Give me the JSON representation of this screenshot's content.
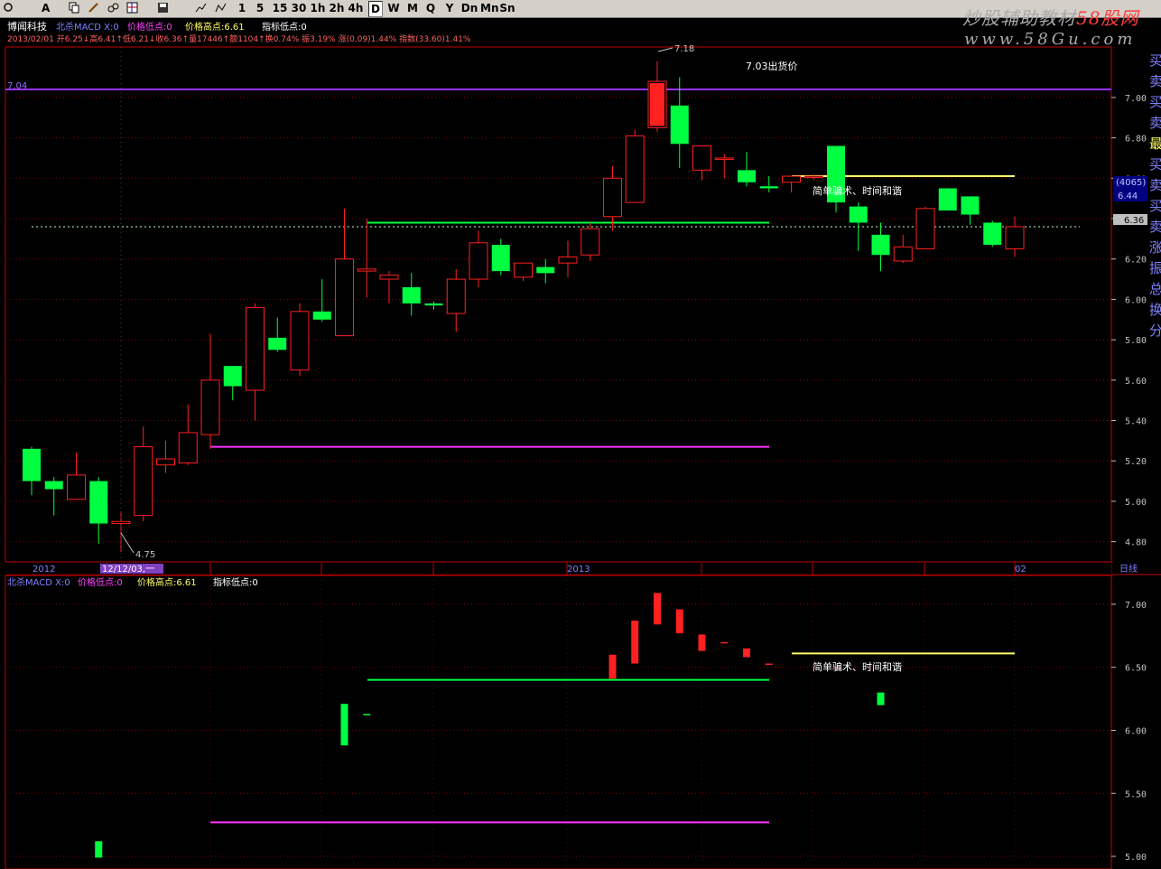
{
  "toolbar": {
    "period_buttons": [
      "1",
      "5",
      "15",
      "30",
      "1h",
      "2h",
      "4h",
      "D",
      "W",
      "M",
      "Q",
      "Y",
      "Dn",
      "Mn",
      "Sn"
    ],
    "active_period": "D"
  },
  "watermark": {
    "title_main": "炒股辅助教材",
    "title_brand": "58股网",
    "url": "www.58Gu.com"
  },
  "header": {
    "stock_name": "博闻科技",
    "indicator_line": "北杀MACD X:0",
    "low_label": "价格低点:0",
    "high_label": "价格高点:6.61",
    "ind_low_label": "指标低点:0",
    "quote_line": "2013/02/01 开6.25↓高6.41↑低6.21↓收6.36↑量17446↑额1104↑换0.74% 振3.19% 涨(0.09)1.44% 指数(33.60)1.41%"
  },
  "lower_header": {
    "name": "北杀MACD X:0",
    "low_label": "价格低点:0",
    "high_label": "价格高点:6.61",
    "ind_low_label": "指标低点:0"
  },
  "annotations": {
    "peak_label": "7.18",
    "trough_label": "4.75",
    "sell_line_left_value": "7.04",
    "sell_note": "7.03出货价",
    "deception_note": "简单骗术、时间和谐",
    "current_price_tag": "6.36",
    "volume_tag": "(4065)",
    "volume_tag_value": "6.44"
  },
  "date_axis": {
    "labels": [
      "2012",
      "12/12/03,一",
      "2013",
      "02"
    ],
    "mode_label": "日线"
  },
  "right_panel_chars": [
    "买",
    "卖",
    "买",
    "卖",
    "最",
    "买",
    "卖",
    "买",
    "卖",
    "涨",
    "振",
    "总",
    "换",
    "分"
  ],
  "colors": {
    "up": "#ff2020",
    "down": "#00ff40",
    "sell_line": "#9933ff",
    "green_line": "#00ff40",
    "yellow_line": "#ffff66",
    "magenta_line": "#ff33ff",
    "axis": "#c0c0c0",
    "grid": "#7f0000"
  },
  "chart_data": [
    {
      "type": "candlestick",
      "title": "博闻科技",
      "period": "日线",
      "ylim": [
        4.7,
        7.25
      ],
      "y_ticks": [
        4.8,
        5.0,
        5.2,
        5.4,
        5.6,
        5.8,
        6.0,
        6.2,
        6.4,
        6.6,
        6.8,
        7.0
      ],
      "candles": [
        {
          "o": 5.26,
          "h": 5.27,
          "l": 5.03,
          "c": 5.1
        },
        {
          "o": 5.1,
          "h": 5.12,
          "l": 4.93,
          "c": 5.06
        },
        {
          "o": 5.01,
          "h": 5.24,
          "l": 5.01,
          "c": 5.13
        },
        {
          "o": 5.1,
          "h": 5.12,
          "l": 4.79,
          "c": 4.89
        },
        {
          "o": 4.89,
          "h": 4.95,
          "l": 4.75,
          "c": 4.9
        },
        {
          "o": 4.93,
          "h": 5.37,
          "l": 4.9,
          "c": 5.27
        },
        {
          "o": 5.18,
          "h": 5.3,
          "l": 5.14,
          "c": 5.21
        },
        {
          "o": 5.19,
          "h": 5.48,
          "l": 5.18,
          "c": 5.34
        },
        {
          "o": 5.33,
          "h": 5.83,
          "l": 5.26,
          "c": 5.6
        },
        {
          "o": 5.67,
          "h": 5.67,
          "l": 5.5,
          "c": 5.57
        },
        {
          "o": 5.55,
          "h": 5.98,
          "l": 5.4,
          "c": 5.96
        },
        {
          "o": 5.81,
          "h": 5.91,
          "l": 5.74,
          "c": 5.75
        },
        {
          "o": 5.65,
          "h": 5.98,
          "l": 5.62,
          "c": 5.94
        },
        {
          "o": 5.94,
          "h": 6.1,
          "l": 5.89,
          "c": 5.9
        },
        {
          "o": 5.82,
          "h": 6.45,
          "l": 5.82,
          "c": 6.2
        },
        {
          "o": 6.14,
          "h": 6.4,
          "l": 6.01,
          "c": 6.15
        },
        {
          "o": 6.1,
          "h": 6.14,
          "l": 5.98,
          "c": 6.12
        },
        {
          "o": 6.06,
          "h": 6.13,
          "l": 5.92,
          "c": 5.98
        },
        {
          "o": 5.98,
          "h": 5.99,
          "l": 5.95,
          "c": 5.97
        },
        {
          "o": 5.93,
          "h": 6.15,
          "l": 5.84,
          "c": 6.1
        },
        {
          "o": 6.1,
          "h": 6.34,
          "l": 6.06,
          "c": 6.28
        },
        {
          "o": 6.27,
          "h": 6.3,
          "l": 6.12,
          "c": 6.14
        },
        {
          "o": 6.11,
          "h": 6.18,
          "l": 6.09,
          "c": 6.18
        },
        {
          "o": 6.16,
          "h": 6.2,
          "l": 6.08,
          "c": 6.13
        },
        {
          "o": 6.18,
          "h": 6.29,
          "l": 6.11,
          "c": 6.21
        },
        {
          "o": 6.22,
          "h": 6.38,
          "l": 6.19,
          "c": 6.35
        },
        {
          "o": 6.41,
          "h": 6.66,
          "l": 6.34,
          "c": 6.6
        },
        {
          "o": 6.48,
          "h": 6.84,
          "l": 6.48,
          "c": 6.81
        },
        {
          "o": 6.85,
          "h": 7.18,
          "l": 6.83,
          "c": 7.08
        },
        {
          "o": 6.96,
          "h": 7.1,
          "l": 6.65,
          "c": 6.77
        },
        {
          "o": 6.64,
          "h": 6.76,
          "l": 6.59,
          "c": 6.76
        },
        {
          "o": 6.7,
          "h": 6.72,
          "l": 6.6,
          "c": 6.7
        },
        {
          "o": 6.64,
          "h": 6.73,
          "l": 6.56,
          "c": 6.58
        },
        {
          "o": 6.56,
          "h": 6.61,
          "l": 6.53,
          "c": 6.55
        },
        {
          "o": 6.58,
          "h": 6.61,
          "l": 6.53,
          "c": 6.61
        },
        {
          "o": 6.61,
          "h": 6.62,
          "l": 6.59,
          "c": 6.61
        },
        {
          "o": 6.76,
          "h": 6.76,
          "l": 6.43,
          "c": 6.48
        },
        {
          "o": 6.46,
          "h": 6.48,
          "l": 6.24,
          "c": 6.38
        },
        {
          "o": 6.32,
          "h": 6.38,
          "l": 6.14,
          "c": 6.22
        },
        {
          "o": 6.19,
          "h": 6.32,
          "l": 6.18,
          "c": 6.26
        },
        {
          "o": 6.25,
          "h": 6.46,
          "l": 6.25,
          "c": 6.45
        },
        {
          "o": 6.55,
          "h": 6.55,
          "l": 6.44,
          "c": 6.44
        },
        {
          "o": 6.51,
          "h": 6.51,
          "l": 6.37,
          "c": 6.42
        },
        {
          "o": 6.38,
          "h": 6.39,
          "l": 6.26,
          "c": 6.27
        },
        {
          "o": 6.25,
          "h": 6.41,
          "l": 6.21,
          "c": 6.36
        }
      ],
      "levels": {
        "sell_price": 7.04,
        "green_support": 6.38,
        "yellow_resistance": 6.61,
        "magenta_support": 5.27,
        "current": 6.36
      }
    },
    {
      "type": "bar",
      "title": "北杀MACD X:0",
      "ylim": [
        4.95,
        7.1
      ],
      "y_ticks": [
        5.0,
        5.5,
        6.0,
        6.5,
        7.0
      ],
      "bars": [
        {
          "i": 3,
          "o": 5.12,
          "c": 4.99
        },
        {
          "i": 14,
          "o": 6.21,
          "c": 5.88
        },
        {
          "i": 15,
          "o": 6.13,
          "c": 6.12
        },
        {
          "i": 26,
          "o": 6.41,
          "c": 6.6
        },
        {
          "i": 27,
          "o": 6.53,
          "c": 6.87
        },
        {
          "i": 28,
          "o": 6.84,
          "c": 7.09
        },
        {
          "i": 29,
          "o": 6.77,
          "c": 6.96
        },
        {
          "i": 30,
          "o": 6.63,
          "c": 6.76
        },
        {
          "i": 31,
          "o": 6.69,
          "c": 6.7
        },
        {
          "i": 32,
          "o": 6.58,
          "c": 6.65
        },
        {
          "i": 33,
          "o": 6.52,
          "c": 6.53
        },
        {
          "i": 38,
          "o": 6.3,
          "c": 6.2
        }
      ],
      "levels": {
        "green_line": 6.4,
        "yellow_line": 6.61,
        "magenta_line": 5.27
      }
    }
  ]
}
